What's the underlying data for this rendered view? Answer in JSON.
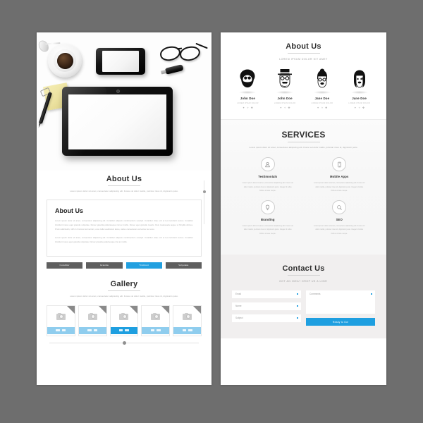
{
  "theme": {
    "background": "#6e6e6e",
    "page_bg": "#ffffff",
    "accent_blue": "#1e9fe0",
    "accent_blue_light": "#8fcdee",
    "button_gray": "#5f5f5f",
    "services_bg": "#f7f7f7",
    "contact_bg": "#f1efef"
  },
  "left_page": {
    "hero": {
      "items": [
        "coffee-cup",
        "spoon",
        "sticky-note",
        "pen",
        "paper-clip",
        "smartphone",
        "eyeglasses",
        "usb-drive",
        "tablet"
      ]
    },
    "about_section": {
      "title": "About Us",
      "subtitle": "Lorem ipsum dolor sit amet, consectetur adipiscing elit. Fusce vel dolor mattis, pulvinar risus id, dignissim justo.",
      "box_title": "About Us",
      "paragraph_1": "Lorem ipsum dolor sit amet, consectetur adipiscing elit. Curabitur aliquam condimentum suscipit. Curabitur vitae orci et leo hendrerit cursus. Curabitur tincidunt metus eget gravida vulputate. Donec gravida pellentesque nisi ac mollis. Donec eget gravida mauris. Duis malesuada augue ut fringilla ultrices. Proin sollicitudin, nibh in rhoncus fermentum, eros nulla vestibulum lacus, varius consectetur est lectus nec eros.",
      "paragraph_2": "Lorem ipsum dolor sit amet, consectetur adipiscing elit. Curabitur aliquam condimentum suscipit. Curabitur vitae orci et leo hendrerit cursus. Curabitur tincidunt metus eget gravida vulputate. Donec gravida pellentesque nisi ac mollis.",
      "buttons": [
        {
          "label": "Curabitur",
          "active": false
        },
        {
          "label": "Gravida",
          "active": false
        },
        {
          "label": "Tincidunt",
          "active": true
        },
        {
          "label": "Vulputate",
          "active": false
        }
      ]
    },
    "gallery_section": {
      "title": "Gallery",
      "subtitle": "Lorem ipsum dolor sit amet, consectetur adipiscing elit. Fusce vel dolor mattis, pulvinar risus id, dignissim justo.",
      "cards": [
        {
          "icon": "camera-icon",
          "corner_icon": "magnifier-icon",
          "active": false
        },
        {
          "icon": "camera-icon",
          "corner_icon": "magnifier-icon",
          "active": false
        },
        {
          "icon": "camera-icon",
          "corner_icon": "magnifier-icon",
          "active": true
        },
        {
          "icon": "camera-icon",
          "corner_icon": "magnifier-icon",
          "active": false
        },
        {
          "icon": "camera-icon",
          "corner_icon": "magnifier-icon",
          "active": false
        }
      ]
    }
  },
  "right_page": {
    "team_section": {
      "title": "About Us",
      "subtitle": "LOREM IPSUM DOLOR SIT AMET",
      "members": [
        {
          "name": "John Doe",
          "role": "LOREM IPSUM DOLOR",
          "avatar": "afro-beard-avatar"
        },
        {
          "name": "John Doe",
          "role": "LOREM IPSUM DOLOR",
          "avatar": "tophat-hipster-avatar"
        },
        {
          "name": "Jane Doe",
          "role": "LOREM IPSUM DOLOR",
          "avatar": "bun-glasses-avatar"
        },
        {
          "name": "Jane Doe",
          "role": "LOREM IPSUM DOLOR",
          "avatar": "long-hair-avatar"
        }
      ],
      "social_icons": [
        "facebook-icon",
        "twitter-icon",
        "pinterest-icon"
      ]
    },
    "services_section": {
      "title": "SERVICES",
      "subtitle": "Lorem ipsum dolor sit amet, consectetur adipiscing elit. Fusce vel dolor mattis, pulvinar risus id, dignissim justo.",
      "items": [
        {
          "name": "Testimonials",
          "icon": "user-icon",
          "desc": "Lorem ipsum dolor sit amet, consectetur adipiscing elit. Fusce vel dolor mattis, pulvinar risus id, dignissim justo. Integer id tellus finibus ornare neque."
        },
        {
          "name": "Mobile Apps",
          "icon": "smartphone-icon",
          "desc": "Lorem ipsum dolor sit amet, consectetur adipiscing elit. Fusce vel dolor mattis, pulvinar risus id, dignissim justo. Integer id tellus finibus ornare neque."
        },
        {
          "name": "Branding",
          "icon": "lightbulb-icon",
          "desc": "Lorem ipsum dolor sit amet, consectetur adipiscing elit. Fusce vel dolor mattis, pulvinar risus id, dignissim justo. Integer id tellus finibus ornare neque."
        },
        {
          "name": "SEO",
          "icon": "magnifier-icon",
          "desc": "Lorem ipsum dolor sit amet, consectetur adipiscing elit. Fusce vel dolor mattis, pulvinar risus id, dignissim justo. Integer id tellus finibus ornare neque."
        }
      ]
    },
    "contact_section": {
      "title": "Contact Us",
      "subtitle": "GOT AN IDEA? DROP US A LINE!",
      "fields": [
        {
          "label": "Email"
        },
        {
          "label": "Name"
        },
        {
          "label": "Subject"
        }
      ],
      "comments_label": "Comments",
      "submit_label": "Ready to Go!"
    }
  }
}
